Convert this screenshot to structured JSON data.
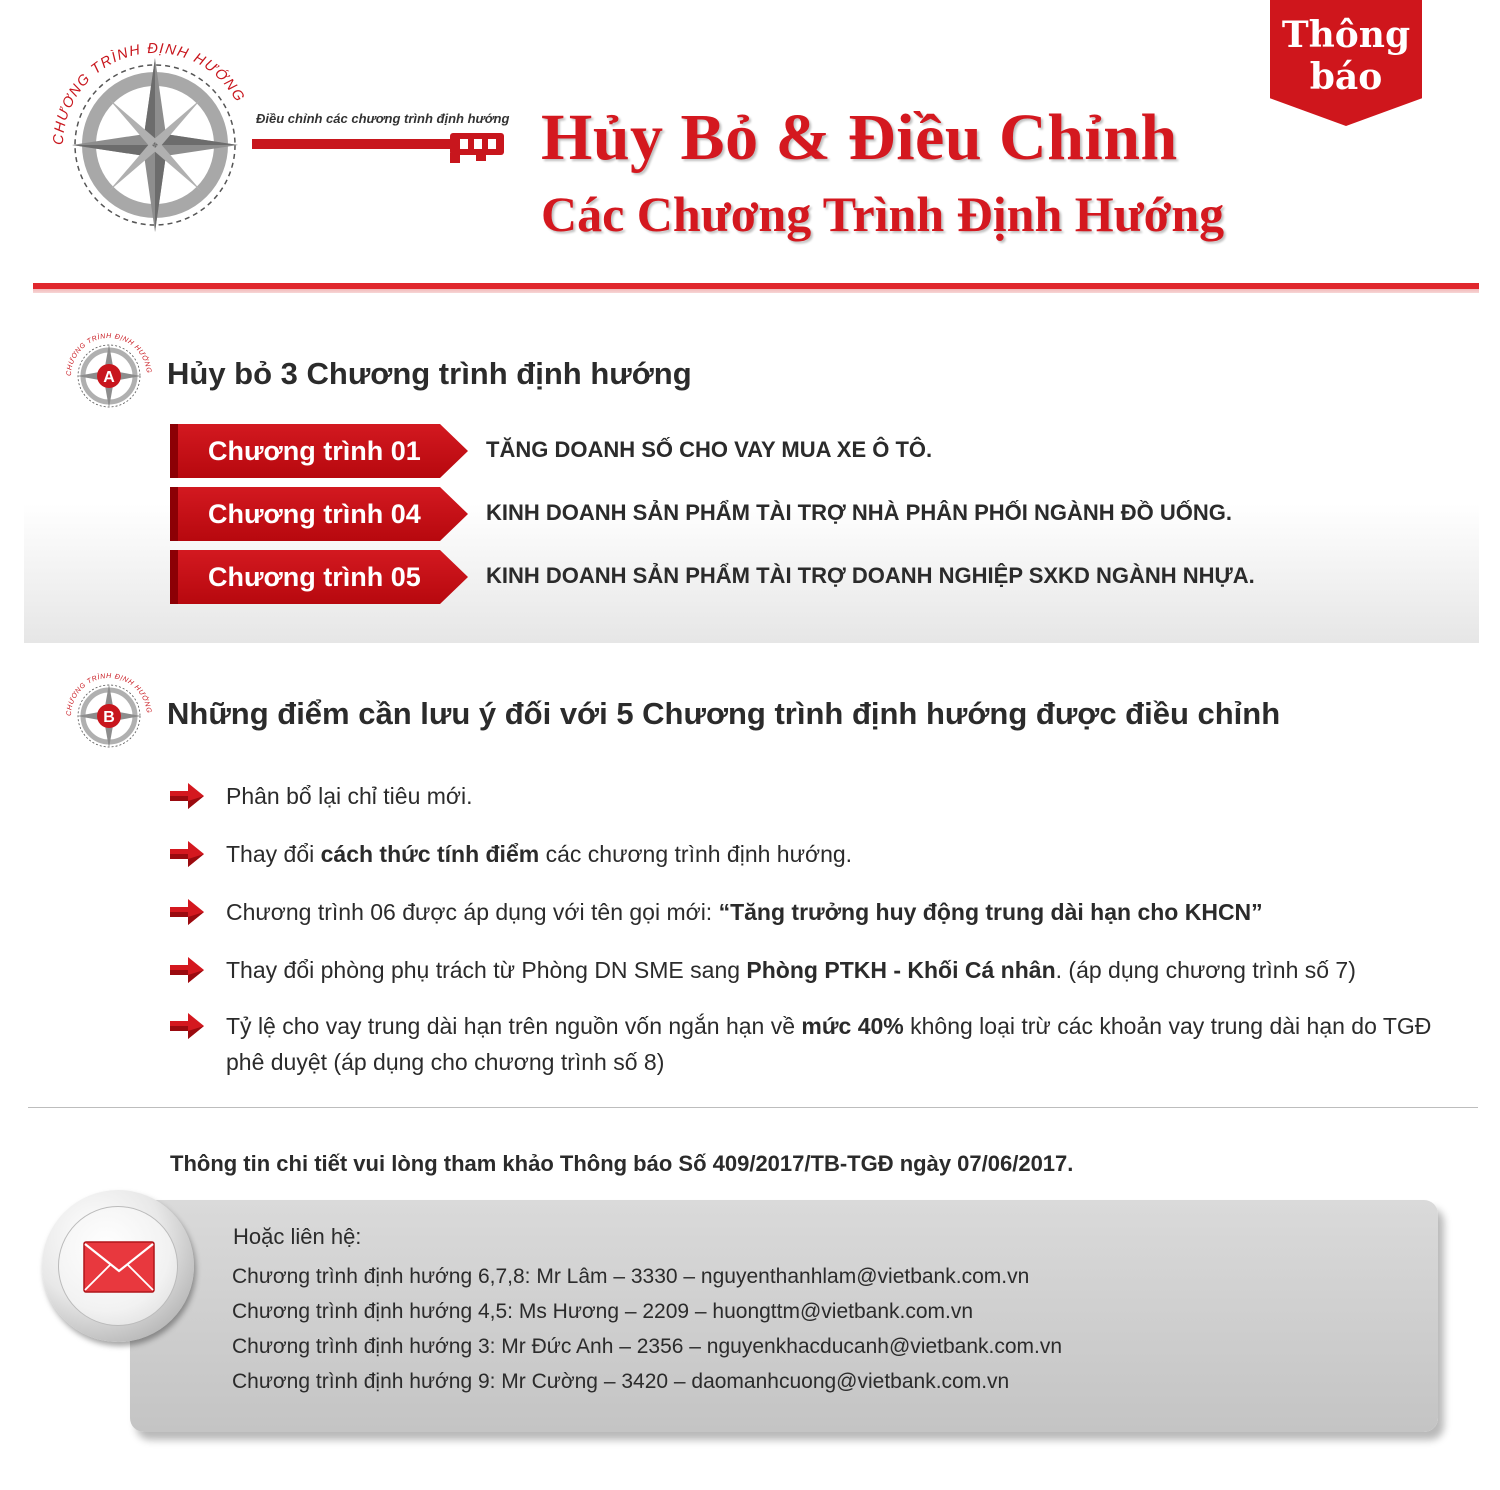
{
  "badge": {
    "line1": "Thông",
    "line2": "báo"
  },
  "logo": {
    "ring_text": "CHƯƠNG TRÌNH ĐỊNH HƯỚNG",
    "key_caption": "Điều chỉnh các chương trình định hướng"
  },
  "header": {
    "title_line1": "Hủy Bỏ & Điều Chỉnh",
    "title_line2": "Các Chương Trình Định Hướng"
  },
  "colors": {
    "accent": "#d4181f",
    "dark_red": "#8c0005",
    "grey_panel": "#d0d0d0"
  },
  "section_a": {
    "icon_letter": "A",
    "title": "Hủy bỏ 3 Chương trình định hướng",
    "programs": [
      {
        "tag": "Chương trình 01",
        "desc": "TĂNG DOANH SỐ CHO VAY MUA XE Ô TÔ."
      },
      {
        "tag": "Chương trình 04",
        "desc": "KINH DOANH SẢN PHẨM TÀI TRỢ NHÀ PHÂN PHỐI NGÀNH ĐỒ UỐNG."
      },
      {
        "tag": "Chương trình 05",
        "desc": "KINH DOANH SẢN PHẨM TÀI TRỢ DOANH NGHIỆP SXKD NGÀNH NHỰA."
      }
    ]
  },
  "section_b": {
    "icon_letter": "B",
    "title": "Những điểm cần lưu ý đối với 5 Chương trình định hướng được điều chỉnh",
    "notes": [
      {
        "pre": "Phân bổ lại chỉ tiêu mới.",
        "bold": "",
        "post": ""
      },
      {
        "pre": "Thay đổi ",
        "bold": "cách thức tính điểm",
        "post": " các chương trình định hướng."
      },
      {
        "pre": "Chương trình 06 được áp dụng với tên gọi mới: ",
        "bold": "“Tăng trưởng huy động trung dài hạn cho KHCN”",
        "post": ""
      },
      {
        "pre": "Thay đổi phòng phụ trách từ Phòng DN SME sang ",
        "bold": "Phòng PTKH - Khối Cá nhân",
        "post": ". (áp dụng chương trình số 7)"
      },
      {
        "pre": "Tỷ lệ cho vay trung dài hạn trên nguồn vốn ngắn hạn về ",
        "bold": "mức 40%",
        "post": " không loại trừ các khoản vay trung dài hạn do TGĐ phê duyệt (áp dụng cho chương trình số 8)"
      }
    ]
  },
  "info_line": "Thông tin chi tiết vui lòng tham khảo Thông báo Số 409/2017/TB-TGĐ ngày 07/06/2017.",
  "contact": {
    "heading": "Hoặc liên hệ:",
    "lines": [
      "Chương trình định hướng 6,7,8: Mr Lâm – 3330 –  nguyenthanhlam@vietbank.com.vn",
      "Chương trình định hướng 4,5: Ms Hương – 2209 – huongttm@vietbank.com.vn",
      "Chương trình định hướng 3: Mr Đức Anh – 2356 – nguyenkhacducanh@vietbank.com.vn",
      "Chương trình định hướng 9: Mr Cường – 3420 – daomanhcuong@vietbank.com.vn"
    ]
  },
  "icons": [
    "compass-logo-icon",
    "key-icon",
    "arrow-right-icon",
    "envelope-icon"
  ]
}
